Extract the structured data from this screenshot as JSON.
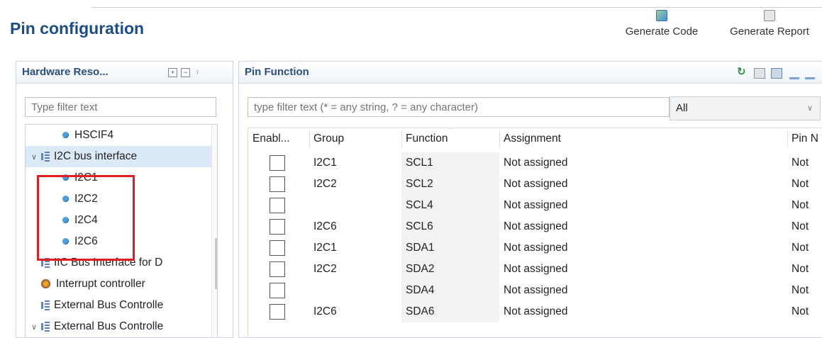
{
  "header": {
    "title": "Pin configuration",
    "generate_code_label": "Generate Code",
    "generate_report_label": "Generate Report"
  },
  "left_panel": {
    "title": "Hardware Reso...",
    "filter_placeholder": "Type filter text",
    "tree": [
      {
        "label": "HSCIF4",
        "icon": "module-dot-icon",
        "level": 2
      },
      {
        "label": "I2C bus interface",
        "icon": "peripheral-icon",
        "level": 1,
        "expanded": true,
        "selected": true
      },
      {
        "label": "I2C1",
        "icon": "module-dot-icon",
        "level": 2
      },
      {
        "label": "I2C2",
        "icon": "module-dot-icon",
        "level": 2
      },
      {
        "label": "I2C4",
        "icon": "module-dot-icon",
        "level": 2
      },
      {
        "label": "I2C6",
        "icon": "module-dot-icon",
        "level": 2
      },
      {
        "label": "IIC Bus Interface for D",
        "icon": "peripheral-icon",
        "level": 1
      },
      {
        "label": "Interrupt controller",
        "icon": "gear-icon",
        "level": 1
      },
      {
        "label": "External Bus Controlle",
        "icon": "peripheral-icon",
        "level": 1
      },
      {
        "label": "External Bus Controlle",
        "icon": "peripheral-icon",
        "level": 1,
        "expanded": true
      }
    ]
  },
  "right_panel": {
    "title": "Pin Function",
    "filter_placeholder": "type filter text (* = any string, ? = any character)",
    "category_selected": "All",
    "columns": [
      "Enabl...",
      "Group",
      "Function",
      "Assignment",
      "Pin N"
    ],
    "rows": [
      {
        "enabled": false,
        "group": "I2C1",
        "function": "SCL1",
        "assignment": "Not assigned",
        "pin": "Not"
      },
      {
        "enabled": false,
        "group": "I2C2",
        "function": "SCL2",
        "assignment": "Not assigned",
        "pin": "Not"
      },
      {
        "enabled": false,
        "group": "",
        "function": "SCL4",
        "assignment": "Not assigned",
        "pin": "Not"
      },
      {
        "enabled": false,
        "group": "I2C6",
        "function": "SCL6",
        "assignment": "Not assigned",
        "pin": "Not"
      },
      {
        "enabled": false,
        "group": "I2C1",
        "function": "SDA1",
        "assignment": "Not assigned",
        "pin": "Not"
      },
      {
        "enabled": false,
        "group": "I2C2",
        "function": "SDA2",
        "assignment": "Not assigned",
        "pin": "Not"
      },
      {
        "enabled": false,
        "group": "",
        "function": "SDA4",
        "assignment": "Not assigned",
        "pin": "Not"
      },
      {
        "enabled": false,
        "group": "I2C6",
        "function": "SDA6",
        "assignment": "Not assigned",
        "pin": "Not"
      }
    ]
  },
  "colors": {
    "title": "#1a4d8a",
    "panel_title": "#2b4f80",
    "selection": "#dbe9f8",
    "highlight": "#e02020"
  }
}
